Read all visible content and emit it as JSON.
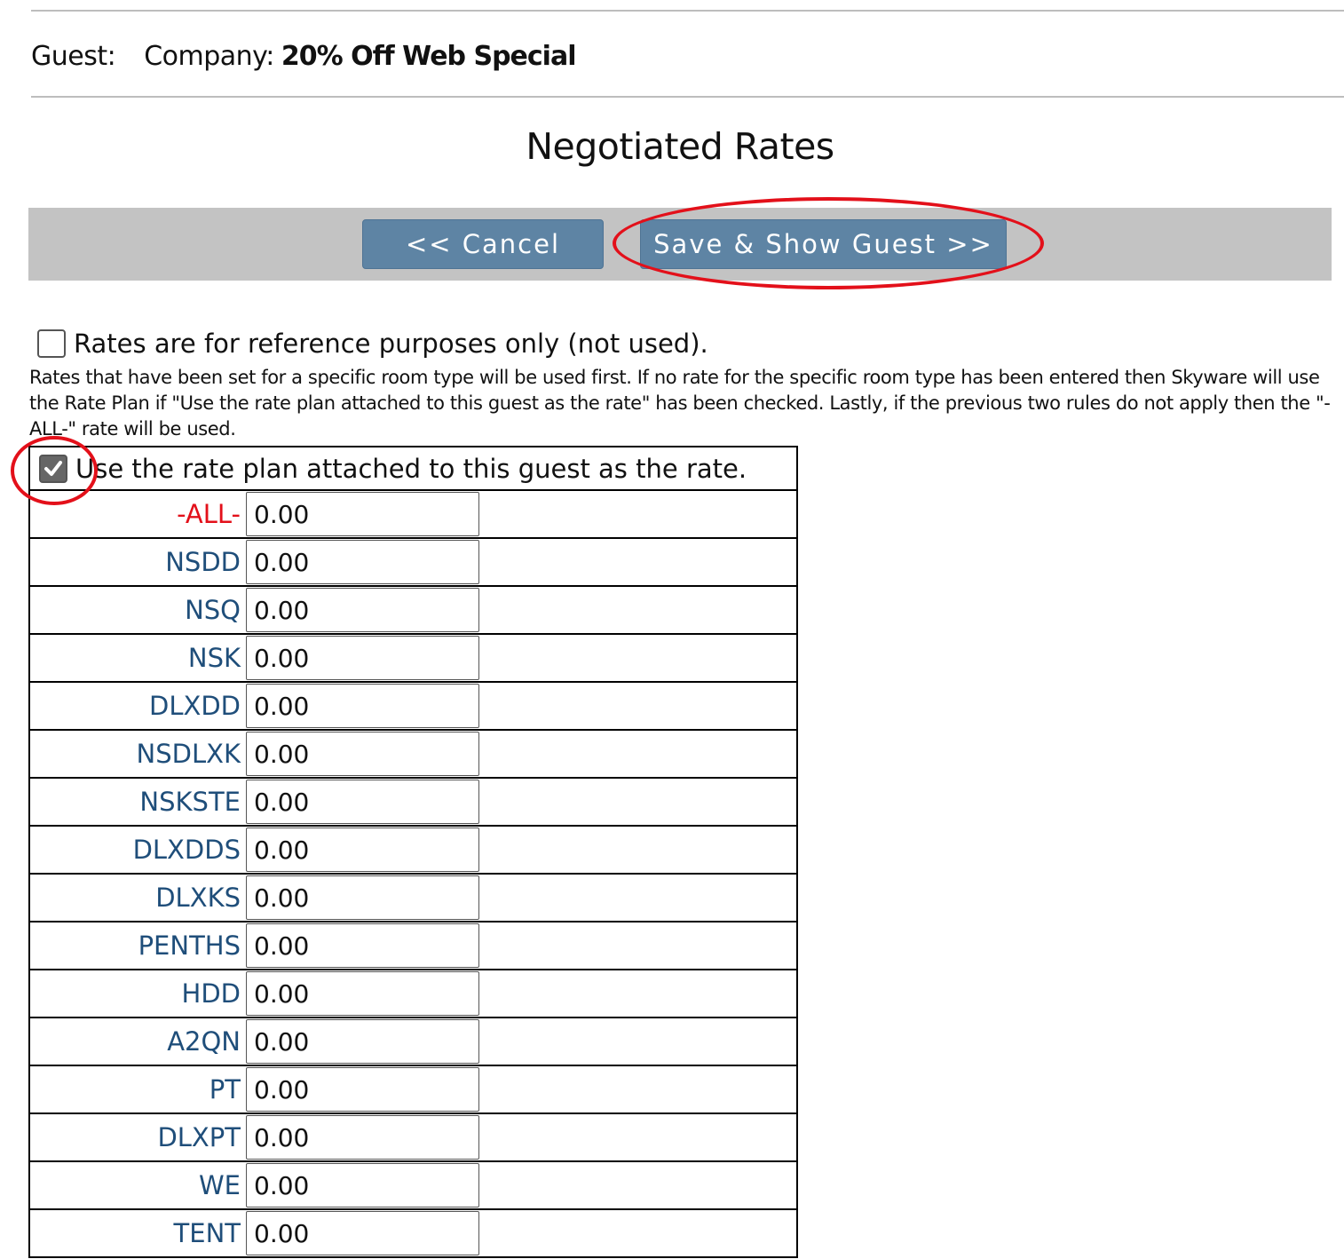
{
  "header": {
    "guest_label": "Guest:",
    "company_label": "Company:",
    "company_value": "20% Off Web Special"
  },
  "title": "Negotiated Rates",
  "toolbar": {
    "cancel_label": "<< Cancel",
    "save_label": "Save & Show Guest >>"
  },
  "options": {
    "reference_only_label": "Rates are for reference purposes only (not used).",
    "reference_only_checked": false,
    "help_text": "Rates that have been set for a specific room type will be used first. If no rate for the specific room type has been entered then Skyware will use the Rate Plan if \"Use the rate plan attached to this guest as the rate\" has been checked. Lastly, if the previous two rules do not apply then the \"-ALL-\" rate will be used.",
    "use_rate_plan_label": "Use the rate plan attached to this guest as the rate.",
    "use_rate_plan_checked": true
  },
  "rates": [
    {
      "code": "-ALL-",
      "value": "0.00"
    },
    {
      "code": "NSDD",
      "value": "0.00"
    },
    {
      "code": "NSQ",
      "value": "0.00"
    },
    {
      "code": "NSK",
      "value": "0.00"
    },
    {
      "code": "DLXDD",
      "value": "0.00"
    },
    {
      "code": "NSDLXK",
      "value": "0.00"
    },
    {
      "code": "NSKSTE",
      "value": "0.00"
    },
    {
      "code": "DLXDDS",
      "value": "0.00"
    },
    {
      "code": "DLXKS",
      "value": "0.00"
    },
    {
      "code": "PENTHS",
      "value": "0.00"
    },
    {
      "code": "HDD",
      "value": "0.00"
    },
    {
      "code": "A2QN",
      "value": "0.00"
    },
    {
      "code": "PT",
      "value": "0.00"
    },
    {
      "code": "DLXPT",
      "value": "0.00"
    },
    {
      "code": "WE",
      "value": "0.00"
    },
    {
      "code": "TENT",
      "value": "0.00"
    }
  ],
  "colors": {
    "button": "#5e84a4",
    "toolbar": "#c3c3c3",
    "all_code": "#e3101a",
    "room_code": "#1f4e7a",
    "annotation": "#e3101a"
  }
}
